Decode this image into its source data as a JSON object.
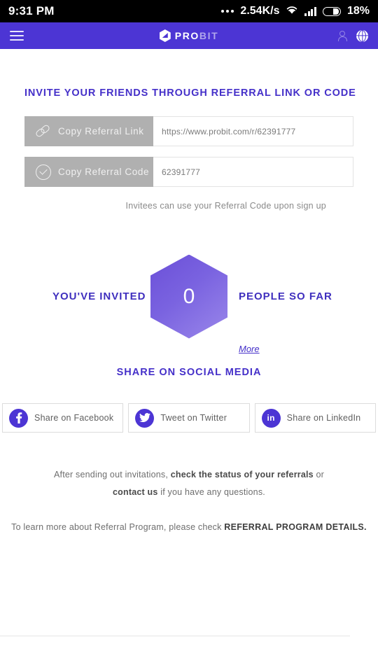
{
  "statusbar": {
    "time": "9:31 PM",
    "dots_icon": "more-dots-icon",
    "network_speed": "2.54K/s",
    "wifi_icon": "wifi-icon",
    "signal_icon": "signal-bars-icon",
    "battery_icon": "battery-icon",
    "battery_percent": "18%"
  },
  "appbar": {
    "menu_icon": "hamburger-menu-icon",
    "logo_icon": "probit-hexagon-logo-icon",
    "brand_primary": "PRO",
    "brand_secondary": "BIT",
    "account_icon": "user-account-icon",
    "language_icon": "globe-language-icon",
    "background_color": "#4c35d4"
  },
  "page": {
    "title": "INVITE YOUR FRIENDS THROUGH REFERRAL LINK OR CODE",
    "accent_color": "#4530c9"
  },
  "referral": {
    "link_row": {
      "icon": "chain-link-icon",
      "button_label": "Copy Referral Link",
      "value": "https://www.probit.com/r/62391777"
    },
    "code_row": {
      "icon": "check-circle-icon",
      "button_label": "Copy Referral Code",
      "value": "62391777"
    },
    "hint": "Invitees can use your Referral Code upon sign up"
  },
  "counter": {
    "left_label": "YOU'VE INVITED",
    "count": "0",
    "right_label": "PEOPLE SO FAR",
    "more_label": "More",
    "hex_gradient_from": "#6b4fd8",
    "hex_gradient_to": "#9a87ea"
  },
  "social": {
    "title": "SHARE ON SOCIAL MEDIA",
    "buttons": [
      {
        "icon": "facebook-icon",
        "label": "Share on Facebook",
        "glyph": "f"
      },
      {
        "icon": "twitter-icon",
        "label": "Tweet on Twitter",
        "glyph": ""
      },
      {
        "icon": "linkedin-icon",
        "label": "Share on LinkedIn",
        "glyph": "in"
      }
    ],
    "icon_color": "#4c35d4"
  },
  "footer": {
    "line1_part1": "After sending out invitations, ",
    "line1_strong": "check the status of your referrals",
    "line1_part2": " or",
    "line2_strong": "contact us",
    "line2_part2": " if you have any questions.",
    "line3_part1": "To learn more about Referral Program, please check ",
    "line3_caps": "REFERRAL PROGRAM DETAILS."
  }
}
